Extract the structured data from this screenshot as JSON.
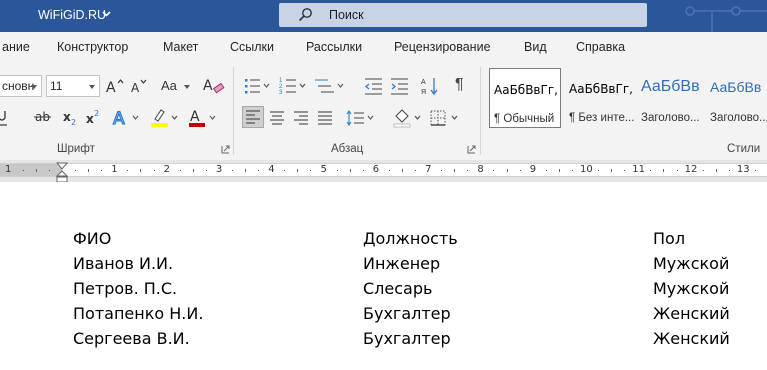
{
  "title_bar": {
    "doc_title": "WiFiGiD.RU",
    "search_placeholder": "Поиск"
  },
  "tabs": [
    "ание",
    "Конструктор",
    "Макет",
    "Ссылки",
    "Рассылки",
    "Рецензирование",
    "Вид",
    "Справка"
  ],
  "ribbon": {
    "font": {
      "name": "сновн",
      "size": "11",
      "case_label": "Aa"
    },
    "groups": {
      "font_label": "Шрифт",
      "paragraph_label": "Абзац",
      "styles_label": "Стили"
    },
    "styles": [
      {
        "sample": "АаБбВвГг,",
        "name": "¶ Обычный"
      },
      {
        "sample": "АаБбВвГг,",
        "name": "¶ Без инте..."
      },
      {
        "sample": "АаБбВв",
        "name": "Заголово..."
      },
      {
        "sample": "АаБбВв",
        "name": "Заголово..."
      }
    ],
    "colors": {
      "highlight": "#ffff00",
      "font_color": "#c00000",
      "text_effects": "#2b7cd3"
    }
  },
  "ruler": {
    "numbers": [
      "1",
      "1",
      "2",
      "3",
      "4",
      "5",
      "6",
      "7",
      "8",
      "9",
      "10",
      "11",
      "12",
      "13"
    ]
  },
  "document": {
    "table": {
      "headers": [
        "ФИО",
        "Должность",
        "Пол"
      ],
      "rows": [
        [
          "Иванов И.И.",
          "Инженер",
          "Мужской"
        ],
        [
          "Петров. П.С.",
          "Слесарь",
          "Мужской"
        ],
        [
          "Потапенко Н.И.",
          "Бухгалтер",
          "Женский"
        ],
        [
          "Сергеева В.И.",
          "Бухгалтер",
          "Женский"
        ]
      ]
    }
  },
  "theme": {
    "title_bar_bg": "#2b579a",
    "ribbon_bg": "#f3f3f3"
  }
}
